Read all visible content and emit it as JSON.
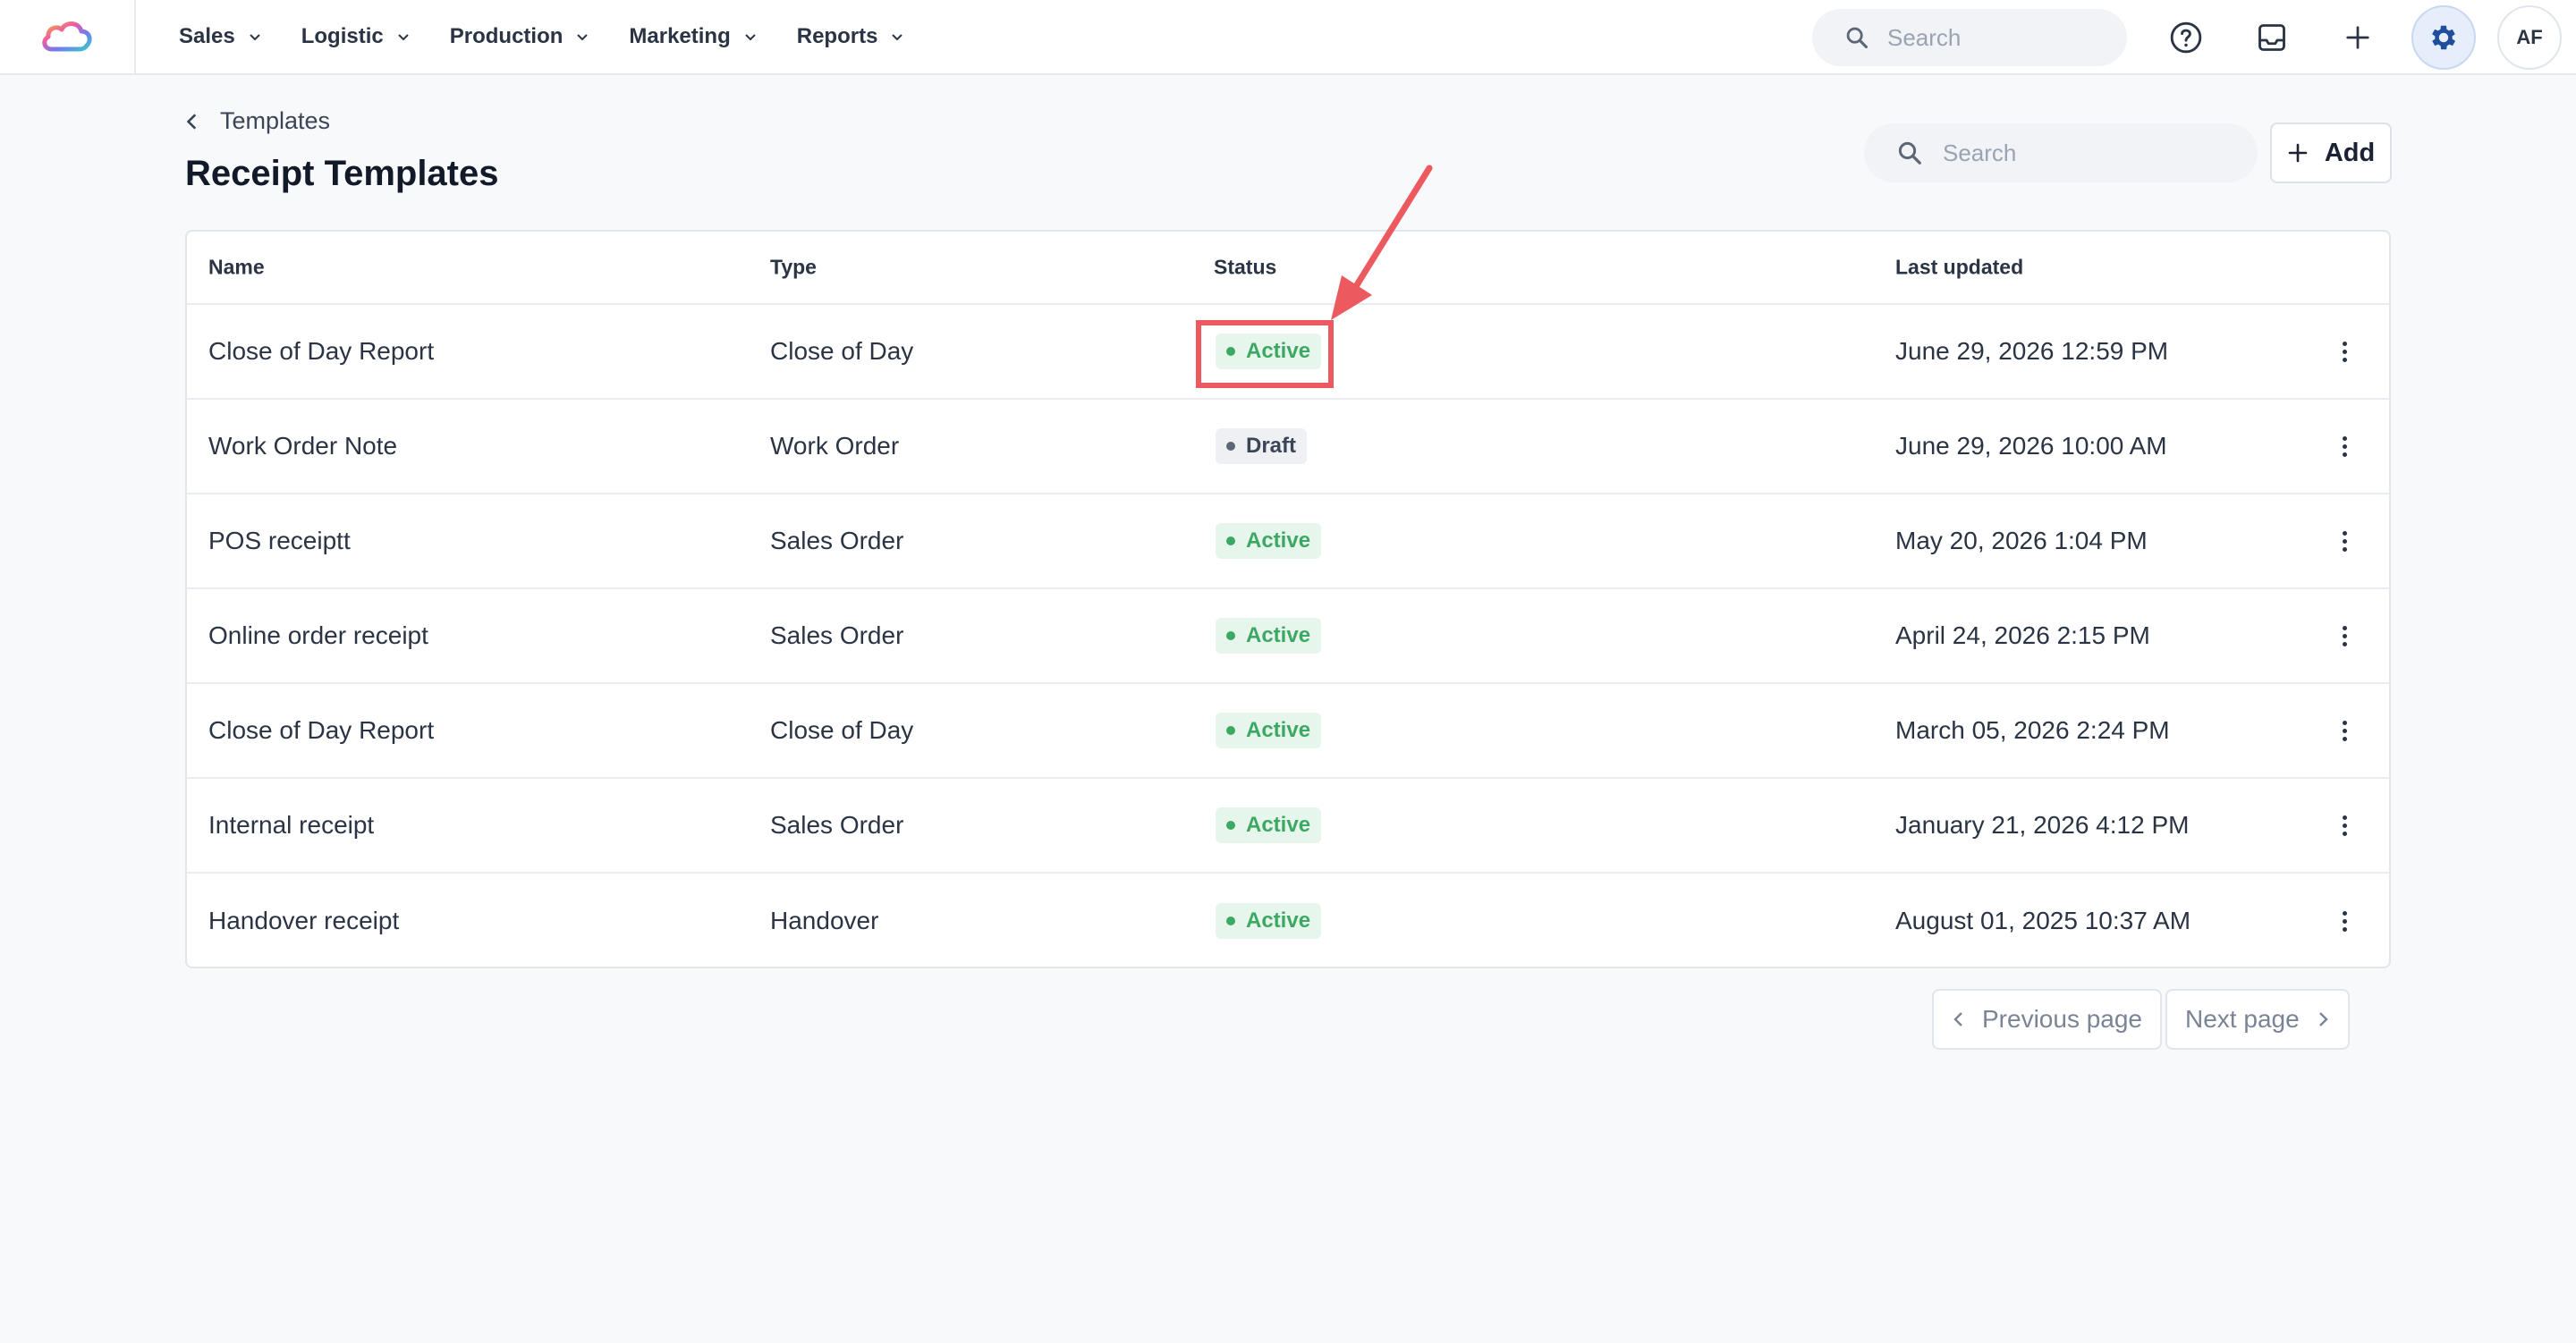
{
  "nav": {
    "items": [
      {
        "label": "Sales"
      },
      {
        "label": "Logistic"
      },
      {
        "label": "Production"
      },
      {
        "label": "Marketing"
      },
      {
        "label": "Reports"
      }
    ],
    "search_placeholder": "Search",
    "avatar_initials": "AF",
    "icons": [
      "help-circle-icon",
      "inbox-icon",
      "plus-icon",
      "gear-icon"
    ]
  },
  "header": {
    "breadcrumb": "Templates",
    "title": "Receipt Templates",
    "search_placeholder": "Search",
    "add_label": "Add"
  },
  "table": {
    "columns": [
      "Name",
      "Type",
      "Status",
      "Last updated"
    ],
    "rows": [
      {
        "name": "Close of Day Report",
        "type": "Close of Day",
        "status": "Active",
        "updated": "June 29, 2026 12:59 PM"
      },
      {
        "name": "Work Order Note",
        "type": "Work Order",
        "status": "Draft",
        "updated": "June 29, 2026 10:00 AM"
      },
      {
        "name": "POS receiptt",
        "type": "Sales Order",
        "status": "Active",
        "updated": "May 20, 2026 1:04 PM"
      },
      {
        "name": "Online order receipt",
        "type": "Sales Order",
        "status": "Active",
        "updated": "April 24, 2026 2:15 PM"
      },
      {
        "name": "Close of Day Report",
        "type": "Close of Day",
        "status": "Active",
        "updated": "March 05, 2026 2:24 PM"
      },
      {
        "name": "Internal receipt",
        "type": "Sales Order",
        "status": "Active",
        "updated": "January 21, 2026 4:12 PM"
      },
      {
        "name": "Handover receipt",
        "type": "Handover",
        "status": "Active",
        "updated": "August 01, 2025 10:37 AM"
      }
    ]
  },
  "pagination": {
    "previous_label": "Previous page",
    "next_label": "Next page"
  },
  "colors": {
    "active_badge": "#3da863",
    "draft_badge": "#5c6677",
    "annotation": "#ec5a5f",
    "settings_active_bg": "#e7eefb"
  }
}
